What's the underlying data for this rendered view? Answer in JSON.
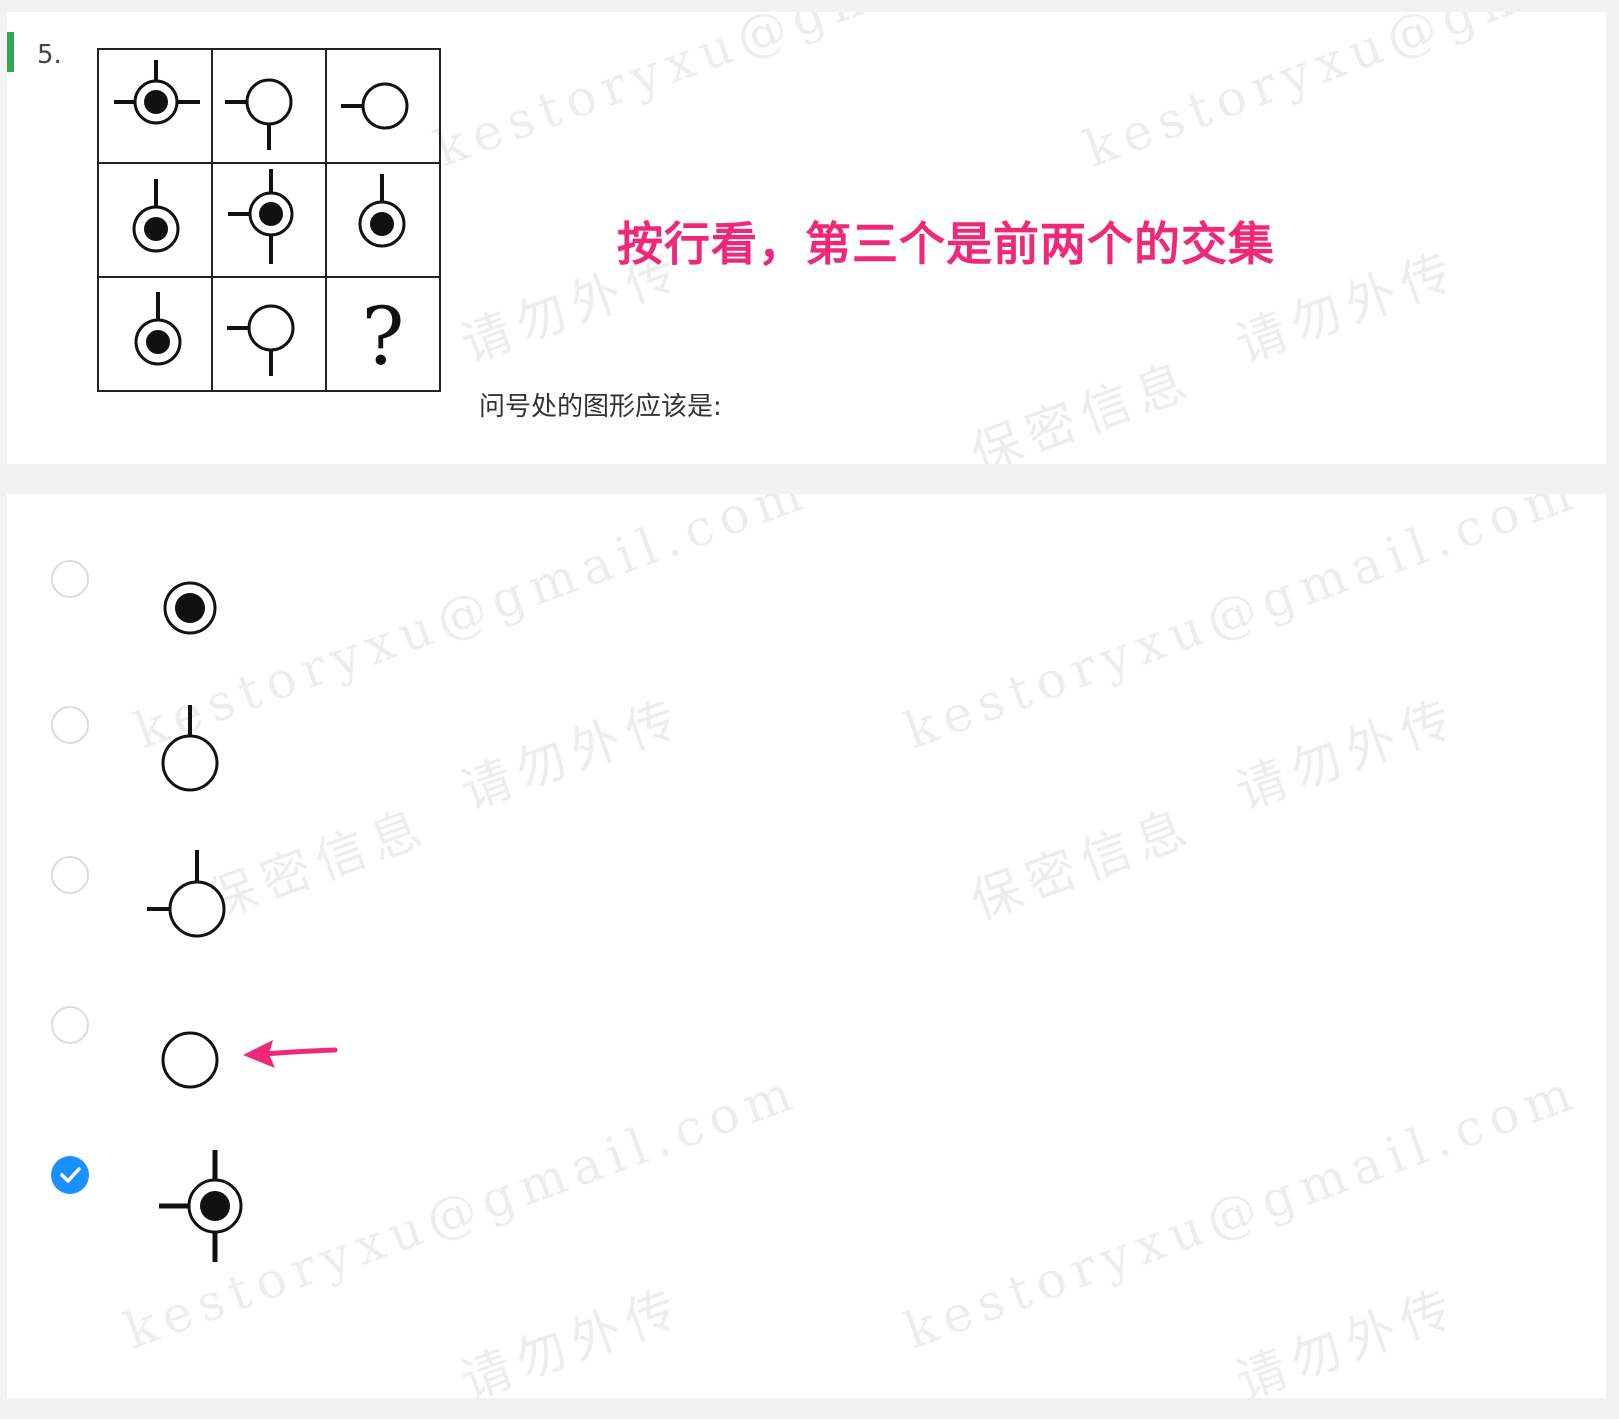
{
  "question": {
    "number": "5.",
    "accent_color": "#2fa84f",
    "annotation": "按行看，第三个是前两个的交集",
    "annotation_color": "#f0287a",
    "prompt": "问号处的图形应该是:",
    "grid": {
      "rows": 3,
      "cols": 3,
      "missing_cell_symbol": "?",
      "cells": [
        [
          "circle-filled-dot-top-left-right-icon",
          "circle-empty-left-bottom-icon",
          "circle-empty-left-icon"
        ],
        [
          "circle-filled-dot-top-icon",
          "circle-filled-dot-top-left-bottom-icon",
          "circle-filled-dot-top-icon"
        ],
        [
          "circle-filled-dot-top-icon",
          "circle-empty-left-bottom-icon",
          "question-mark-icon"
        ]
      ]
    }
  },
  "options": [
    {
      "figure": "circle-filled-dot-icon",
      "checked": false
    },
    {
      "figure": "circle-empty-top-icon",
      "checked": false
    },
    {
      "figure": "circle-empty-top-left-icon",
      "checked": false
    },
    {
      "figure": "circle-empty-icon",
      "checked": false,
      "annotated_with_arrow": true
    },
    {
      "figure": "circle-filled-dot-top-left-bottom-icon",
      "checked": true
    }
  ],
  "selected_color": "#1890ff",
  "watermarks": [
    "kestoryxu@gmail.com",
    "请勿外传",
    "保密信息"
  ]
}
